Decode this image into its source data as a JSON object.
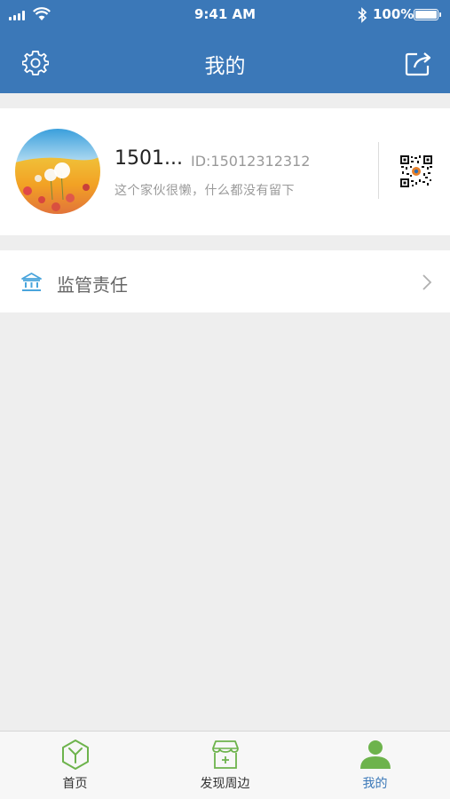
{
  "status_bar": {
    "time": "9:41 AM",
    "battery": "100%"
  },
  "header": {
    "title": "我的"
  },
  "profile": {
    "nickname": "1501...",
    "user_id": "ID:15012312312",
    "signature": "这个家伙很懒，什么都没有留下"
  },
  "menu": [
    {
      "label": "监管责任",
      "icon": "bank-icon"
    }
  ],
  "tabbar": {
    "tabs": [
      {
        "label": "首页",
        "icon": "cube-icon"
      },
      {
        "label": "发现周边",
        "icon": "store-icon"
      },
      {
        "label": "我的",
        "icon": "person-icon",
        "active": true
      }
    ]
  },
  "colors": {
    "brand": "#3b78b8",
    "tab_icon": "#6db34c"
  }
}
